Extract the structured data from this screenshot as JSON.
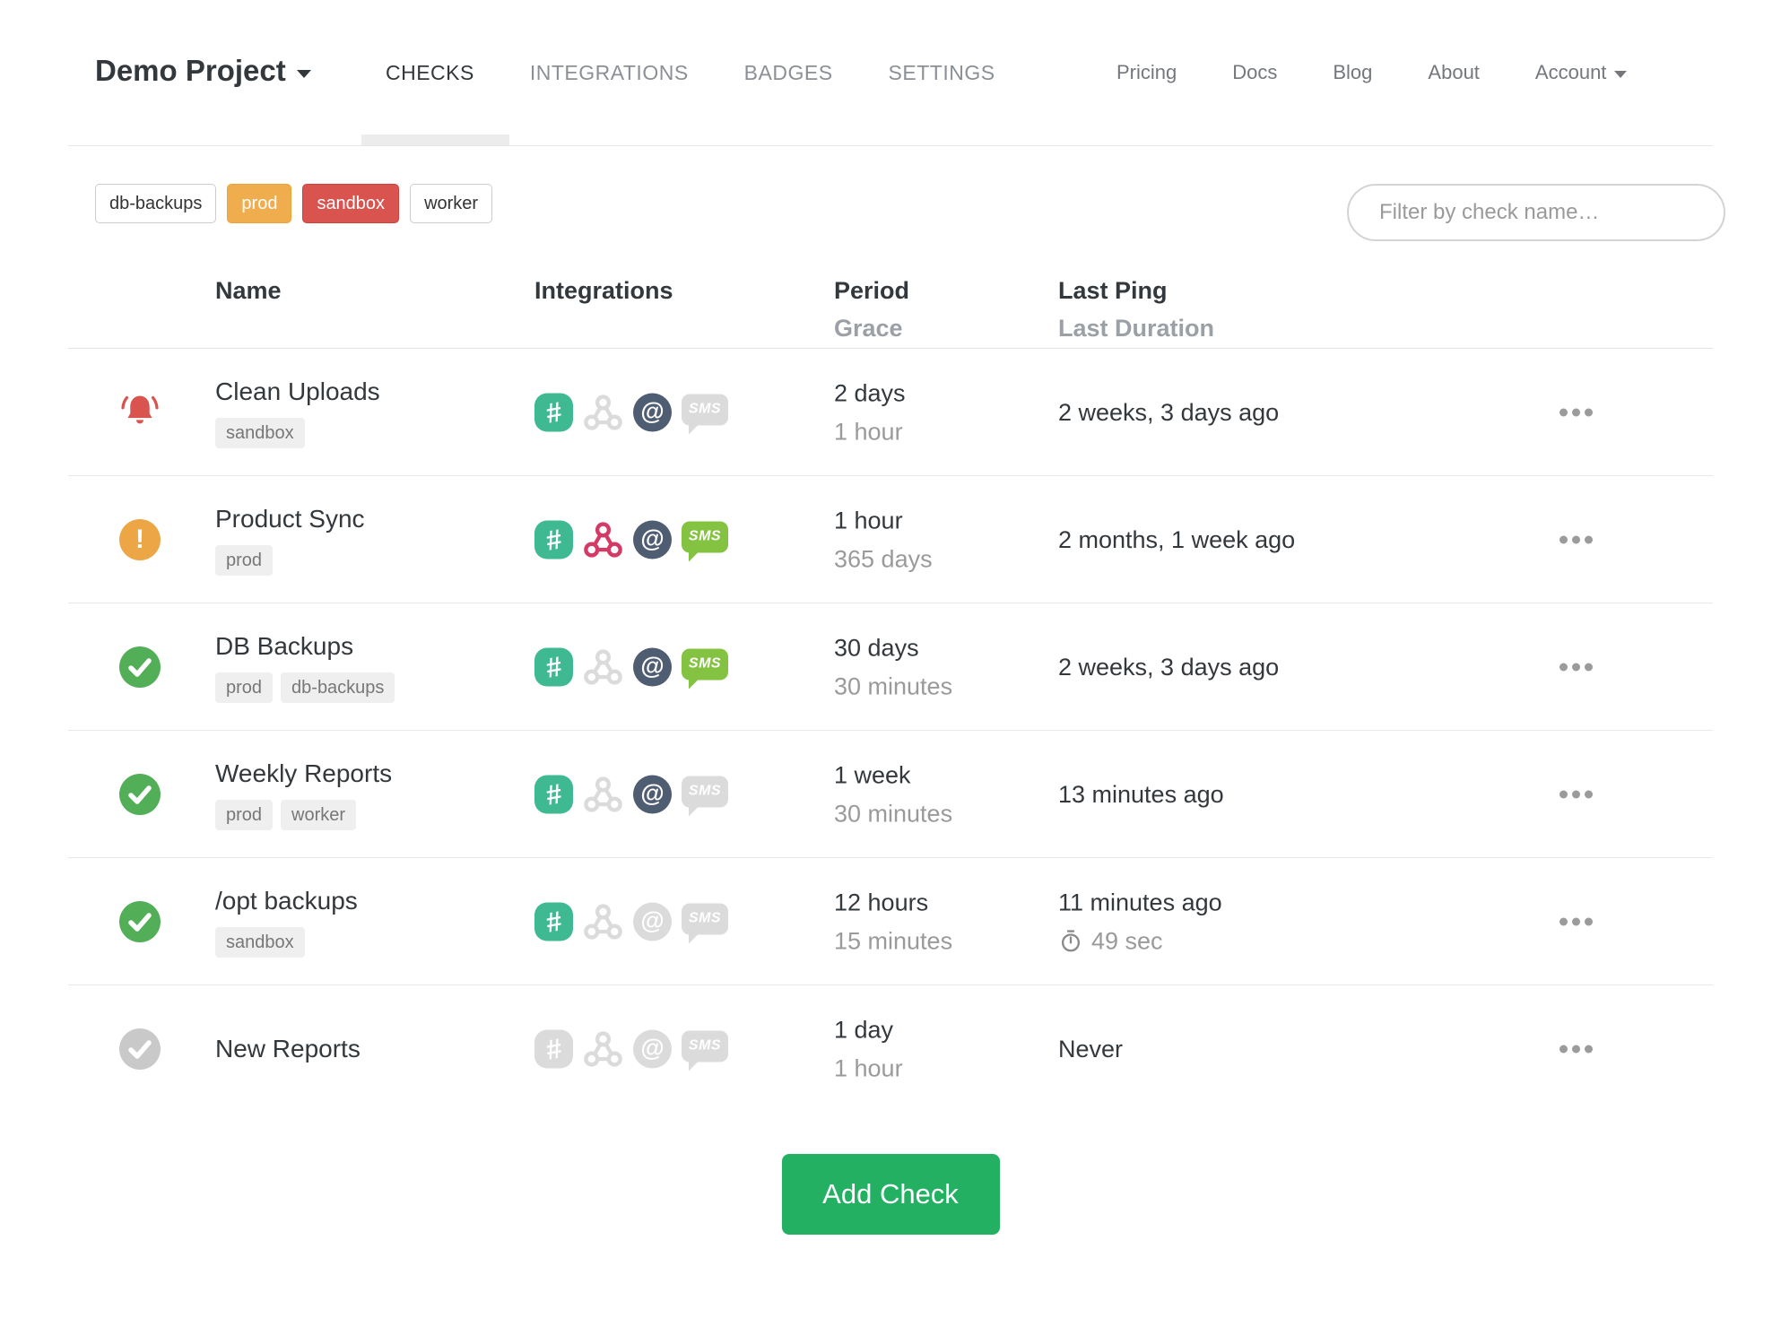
{
  "nav": {
    "project": "Demo Project",
    "tabs": [
      {
        "label": "CHECKS",
        "active": true
      },
      {
        "label": "INTEGRATIONS",
        "active": false
      },
      {
        "label": "BADGES",
        "active": false
      },
      {
        "label": "SETTINGS",
        "active": false
      }
    ],
    "links": [
      {
        "label": "Pricing"
      },
      {
        "label": "Docs"
      },
      {
        "label": "Blog"
      },
      {
        "label": "About"
      }
    ],
    "account": "Account"
  },
  "filters": {
    "tags": [
      {
        "label": "db-backups",
        "style": "default"
      },
      {
        "label": "prod",
        "style": "warning"
      },
      {
        "label": "sandbox",
        "style": "danger"
      },
      {
        "label": "worker",
        "style": "default"
      }
    ],
    "search_placeholder": "Filter by check name…"
  },
  "table": {
    "headers": {
      "name": "Name",
      "integrations": "Integrations",
      "period": "Period",
      "grace": "Grace",
      "last_ping": "Last Ping",
      "last_duration": "Last Duration"
    },
    "rows": [
      {
        "status": "alert",
        "name": "Clean Uploads",
        "tags": [
          "sandbox"
        ],
        "integrations": {
          "slack": true,
          "webhook": false,
          "email": true,
          "sms": false
        },
        "period": "2 days",
        "grace": "1 hour",
        "last_ping": "2 weeks, 3 days ago",
        "last_duration": ""
      },
      {
        "status": "warning",
        "name": "Product Sync",
        "tags": [
          "prod"
        ],
        "integrations": {
          "slack": true,
          "webhook": true,
          "email": true,
          "sms": true
        },
        "period": "1 hour",
        "grace": "365 days",
        "last_ping": "2 months, 1 week ago",
        "last_duration": ""
      },
      {
        "status": "ok",
        "name": "DB Backups",
        "tags": [
          "prod",
          "db-backups"
        ],
        "integrations": {
          "slack": true,
          "webhook": false,
          "email": true,
          "sms": true
        },
        "period": "30 days",
        "grace": "30 minutes",
        "last_ping": "2 weeks, 3 days ago",
        "last_duration": ""
      },
      {
        "status": "ok",
        "name": "Weekly Reports",
        "tags": [
          "prod",
          "worker"
        ],
        "integrations": {
          "slack": true,
          "webhook": false,
          "email": true,
          "sms": false
        },
        "period": "1 week",
        "grace": "30 minutes",
        "last_ping": "13 minutes ago",
        "last_duration": ""
      },
      {
        "status": "ok",
        "name": "/opt backups",
        "tags": [
          "sandbox"
        ],
        "integrations": {
          "slack": true,
          "webhook": false,
          "email": false,
          "sms": false
        },
        "period": "12 hours",
        "grace": "15 minutes",
        "last_ping": "11 minutes ago",
        "last_duration": "49 sec"
      },
      {
        "status": "new",
        "name": "New Reports",
        "tags": [],
        "integrations": {
          "slack": false,
          "webhook": false,
          "email": false,
          "sms": false
        },
        "period": "1 day",
        "grace": "1 hour",
        "last_ping": "Never",
        "last_duration": ""
      }
    ]
  },
  "actions": {
    "add_check": "Add Check"
  },
  "colors": {
    "slack_active": "#3eb991",
    "webhook_active": "#d43a65",
    "email_active": "#4f5d72",
    "sms_active": "#83c341",
    "integration_inactive": "#dbdbdb",
    "status_ok": "#53af57",
    "status_warning": "#eda645",
    "status_new": "#c9c9c9",
    "status_alert": "#d9534f",
    "tag_warning": "#f0ad4e",
    "tag_danger": "#d9534f",
    "add_button": "#23b062"
  }
}
